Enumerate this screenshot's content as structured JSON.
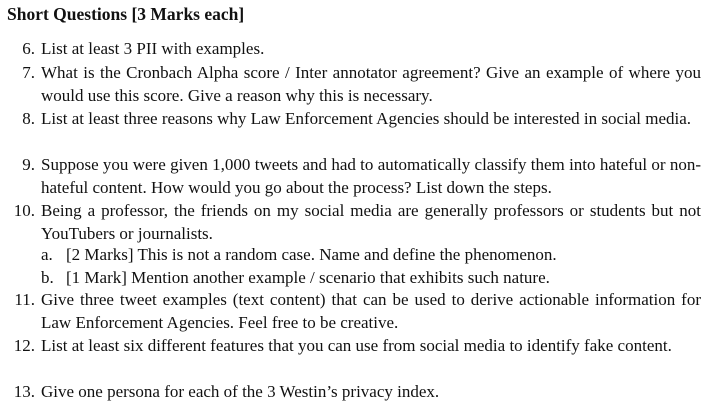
{
  "heading": "Short Questions [3 Marks each]",
  "questions": [
    {
      "number": "6.",
      "text": "List at least 3 PII with examples."
    },
    {
      "number": "7.",
      "text": "What is the Cronbach Alpha score / Inter annotator agreement? Give an example of where you would use this score. Give a reason why this is necessary."
    },
    {
      "number": "8.",
      "text": "List at least three reasons why Law Enforcement Agencies should be interested in social media."
    },
    {
      "number": "9.",
      "text": "Suppose you were given 1,000 tweets and had to automatically classify them into hateful or non-hateful content. How would you go about the process? List down the steps."
    },
    {
      "number": "10.",
      "text": "Being a professor, the friends on my social media are generally professors or students but not YouTubers or journalists.",
      "subparts": [
        {
          "letter": "a.",
          "text": "[2 Marks] This is not a random case. Name and define the phenomenon."
        },
        {
          "letter": "b.",
          "text": "[1 Mark] Mention another example / scenario that exhibits such nature."
        }
      ]
    },
    {
      "number": "11.",
      "text": "Give three tweet examples (text content) that can be used to derive actionable information for Law Enforcement Agencies. Feel free to be creative."
    },
    {
      "number": "12.",
      "text": "List at least six different features that you can use from social media to identify fake content."
    },
    {
      "number": "13.",
      "text": "Give one persona for each of the 3 Westin’s privacy index."
    }
  ]
}
